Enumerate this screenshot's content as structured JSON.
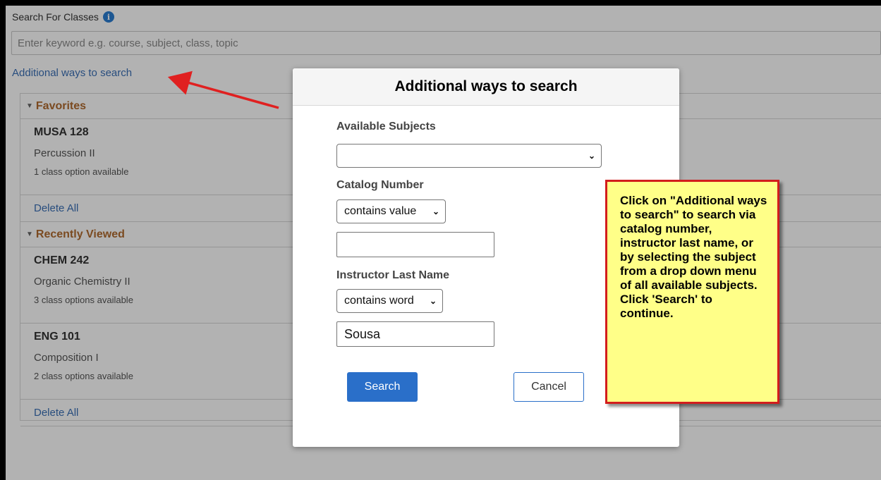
{
  "search": {
    "label": "Search For Classes",
    "info_glyph": "i",
    "placeholder": "Enter keyword e.g. course, subject, class, topic"
  },
  "additional_link": "Additional ways to search",
  "favorites": {
    "heading": "Favorites",
    "courses": [
      {
        "code": "MUSA 128",
        "title": "Percussion II",
        "options": "1 class option available"
      }
    ],
    "delete_all": "Delete All"
  },
  "recently_viewed": {
    "heading": "Recently Viewed",
    "courses": [
      {
        "code": "CHEM 242",
        "title": "Organic Chemistry II",
        "options": "3 class options available"
      },
      {
        "code": "ENG 101",
        "title": "Composition I",
        "options": "2 class options available"
      }
    ],
    "delete_all": "Delete All"
  },
  "modal": {
    "title": "Additional ways to search",
    "available_subjects_label": "Available Subjects",
    "available_subjects_value": "",
    "catalog_number_label": "Catalog Number",
    "catalog_operator": "contains value",
    "catalog_value": "",
    "instructor_label": "Instructor Last Name",
    "instructor_operator": "contains word",
    "instructor_value": "Sousa",
    "search_button": "Search",
    "cancel_button": "Cancel"
  },
  "callout": {
    "text": "Click on \"Additional ways to search\" to search via catalog number, instructor last name, or by selecting the subject from a drop down menu of all available subjects. Click 'Search' to continue."
  },
  "colors": {
    "link": "#3a6fb5",
    "section_heading": "#b06b2f",
    "primary_button": "#2a6fc9",
    "callout_fill": "#ffff88",
    "callout_border": "#d21d1d",
    "arrow": "#e02020"
  },
  "icons": {
    "info": "info-circle-icon",
    "caret": "caret-down-icon",
    "chevron": "chevron-down-icon"
  }
}
